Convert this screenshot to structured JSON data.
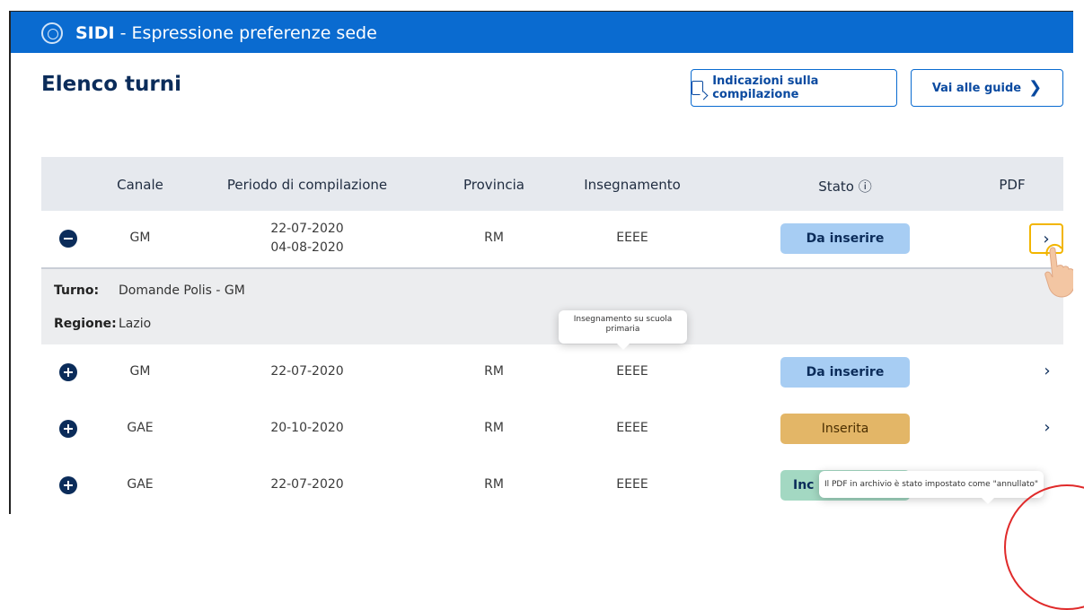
{
  "app": {
    "name": "SIDI",
    "separator": " - ",
    "subtitle": "Espressione preferenze sede"
  },
  "page": {
    "title": "Elenco turni"
  },
  "buttons": {
    "indicazioni": "Indicazioni sulla compilazione",
    "guide": "Vai alle guide",
    "guide_chevron": "❯"
  },
  "table": {
    "headers": {
      "canale": "Canale",
      "periodo": "Periodo di compilazione",
      "provincia": "Provincia",
      "insegnamento": "Insegnamento",
      "stato": "Stato ⓘ",
      "pdf": "PDF"
    },
    "rows": [
      {
        "canale": "GM",
        "periodo_start": "22-07-2020",
        "periodo_end": "04-08-2020",
        "provincia": "RM",
        "insegnamento": "EEEE",
        "stato": "Da inserire",
        "pdf": "›",
        "expanded": true
      },
      {
        "canale": "GM",
        "periodo": "22-07-2020",
        "provincia": "RM",
        "insegnamento": "EEEE",
        "stato": "Da inserire",
        "pdf": "›"
      },
      {
        "canale": "GAE",
        "periodo": "20-10-2020",
        "provincia": "RM",
        "insegnamento": "EEEE",
        "stato": "Inserita",
        "pdf": "›"
      },
      {
        "canale": "GAE",
        "periodo": "22-07-2020",
        "provincia": "RM",
        "insegnamento": "EEEE",
        "stato": "Inc"
      }
    ],
    "detail": {
      "turno_label": "Turno:",
      "turno_value": "Domande Polis - GM",
      "regione_label": "Regione:",
      "regione_value": "Lazio"
    }
  },
  "tooltips": {
    "insegnamento": "Insegnamento su scuola primaria",
    "pdf_annullato": "Il PDF in archivio è stato impostato come \"annullato\""
  },
  "colors": {
    "header_blue": "#0a6bd0",
    "navy": "#0b2c5a",
    "status_blue": "#a7cdf3",
    "status_orange": "#e3b667",
    "status_green": "#a3d8c2",
    "highlight_yellow": "#f2b500"
  }
}
